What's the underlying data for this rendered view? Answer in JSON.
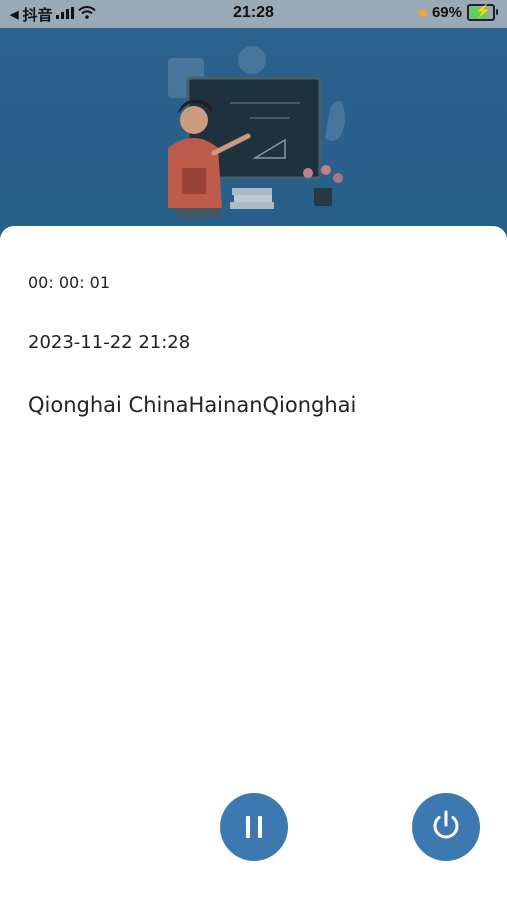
{
  "status_bar": {
    "back_app": "抖音",
    "time": "21:28",
    "battery_percent": "69%",
    "battery_level": 0.69,
    "colors": {
      "charge_dot": "#f2a23a",
      "battery_fill": "#5bd35b"
    }
  },
  "recording": {
    "elapsed": "00: 00: 01",
    "datetime": "2023-11-22 21:28",
    "location": "Qionghai ChinaHainanQionghai"
  },
  "controls": {
    "pause_icon": "pause-icon",
    "power_icon": "power-icon",
    "accent_color": "#3d79b0"
  },
  "hero": {
    "background_color": "#2f6896",
    "illustration": "teacher-at-blackboard"
  }
}
